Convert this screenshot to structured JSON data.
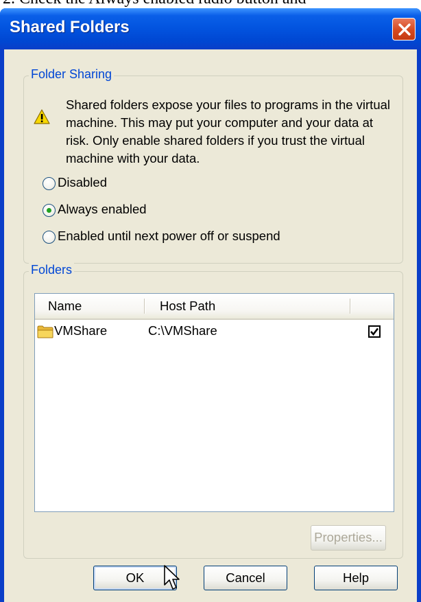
{
  "caption": "2.  Check the Always enabled radio button and",
  "window": {
    "title": "Shared Folders"
  },
  "folder_sharing": {
    "group_label": "Folder Sharing",
    "warning_text": "Shared folders expose your files to programs in the virtual machine. This may put your computer and your data at risk. Only enable shared folders if you trust the virtual machine with your data.",
    "options": [
      {
        "label": "Disabled",
        "selected": false
      },
      {
        "label": "Always enabled",
        "selected": true
      },
      {
        "label": "Enabled until next power off or suspend",
        "selected": false
      }
    ]
  },
  "folders": {
    "group_label": "Folders",
    "columns": [
      "Name",
      "Host Path",
      ""
    ],
    "rows": [
      {
        "name": "VMShare",
        "host_path": "C:\\VMShare",
        "enabled": true
      }
    ],
    "properties_label": "Properties..."
  },
  "buttons": {
    "ok": "OK",
    "cancel": "Cancel",
    "help": "Help"
  },
  "colors": {
    "title_bar": "#0a5fe8",
    "group_label": "#0046d5",
    "dialog_face": "#ece9d8"
  }
}
